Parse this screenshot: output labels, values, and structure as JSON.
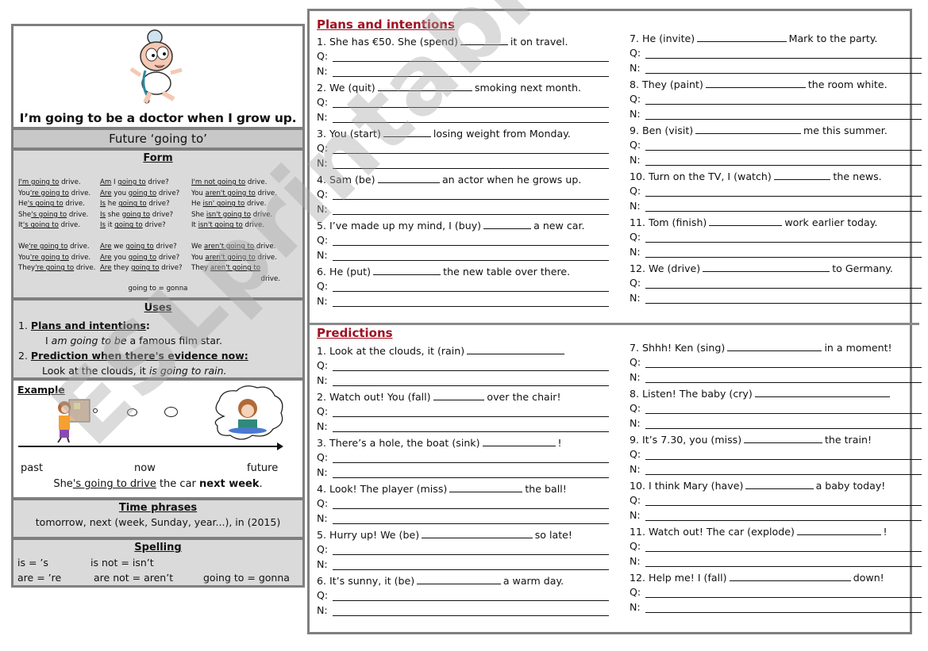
{
  "left": {
    "hero_caption": "I’m going to be a doctor when I grow up.",
    "hero_image": "baby-doctor-cartoon",
    "title": "Future ‘going to’",
    "form": {
      "heading": "Form",
      "rows": [
        {
          "aff_pre": "",
          "aff_u": "I'm going to",
          "aff_post": " drive.",
          "q_u1": "Am",
          "q_mid": " I ",
          "q_u2": "going to",
          "q_post": " drive?",
          "neg_pre": "",
          "neg_u": "I'm not going to",
          "neg_post": " drive."
        },
        {
          "aff_pre": "You",
          "aff_u": "'re going to",
          "aff_post": " drive.",
          "q_u1": "Are",
          "q_mid": " you ",
          "q_u2": "going to",
          "q_post": " drive?",
          "neg_pre": "You ",
          "neg_u": "aren't going to",
          "neg_post": " drive."
        },
        {
          "aff_pre": "He",
          "aff_u": "'s going to",
          "aff_post": " drive.",
          "q_u1": "Is",
          "q_mid": " he ",
          "q_u2": "going to",
          "q_post": " drive?",
          "neg_pre": "He ",
          "neg_u": "isn' going to",
          "neg_post": " drive."
        },
        {
          "aff_pre": "She",
          "aff_u": "'s going to",
          "aff_post": " drive.",
          "q_u1": "Is",
          "q_mid": " she ",
          "q_u2": "going to",
          "q_post": " drive?",
          "neg_pre": "She ",
          "neg_u": "isn't going to",
          "neg_post": " drive."
        },
        {
          "aff_pre": "It",
          "aff_u": "'s going to",
          "aff_post": " drive.",
          "q_u1": "Is",
          "q_mid": " it ",
          "q_u2": "going to",
          "q_post": " drive?",
          "neg_pre": "It ",
          "neg_u": "isn't going to",
          "neg_post": " drive."
        },
        {
          "aff_pre": "We",
          "aff_u": "'re going to",
          "aff_post": " drive.",
          "q_u1": "Are",
          "q_mid": " we ",
          "q_u2": "going to",
          "q_post": " drive?",
          "neg_pre": "We ",
          "neg_u": "aren't going to",
          "neg_post": " drive."
        },
        {
          "aff_pre": "You",
          "aff_u": "'re going to",
          "aff_post": " drive.",
          "q_u1": "Are",
          "q_mid": " you ",
          "q_u2": "going to",
          "q_post": " drive?",
          "neg_pre": "You ",
          "neg_u": "aren't going to",
          "neg_post": " drive."
        },
        {
          "aff_pre": "They",
          "aff_u": "'re going to",
          "aff_post": " drive.",
          "q_u1": "Are",
          "q_mid": " they ",
          "q_u2": "going to",
          "q_post": " drive?",
          "neg_pre": "They ",
          "neg_u": "aren't going to",
          "neg_post": ""
        }
      ],
      "wrap_word": "drive.",
      "note": "going to = gonna"
    },
    "uses": {
      "heading": "Uses",
      "item1_num": "1.",
      "item1_label": "Plans and intentions",
      "item1_colon": ":",
      "item1_ex_pre": "I ",
      "item1_ex_it": "am going to be",
      "item1_ex_post": " a famous film star.",
      "item2_num": "2.",
      "item2_label": "Prediction when there's evidence now:",
      "item2_ex_pre": "Look at the clouds, it ",
      "item2_ex_it": "is going to rain."
    },
    "example": {
      "heading": "Example",
      "image_left": "woman-at-noticeboard",
      "image_right": "woman-driving-thought-cloud",
      "past": "past",
      "now": "now",
      "future": "future",
      "sent_pre": "She",
      "sent_u": "'s going to drive",
      "sent_mid": " the car ",
      "sent_b": "next week",
      "sent_end": "."
    },
    "time_phrases": {
      "heading": "Time phrases",
      "text": "tomorrow, next (week, Sunday, year...), in (2015)"
    },
    "spelling": {
      "heading": "Spelling",
      "items": [
        "is = ’s",
        "is not = isn’t",
        "are = ’re",
        "are not = aren’t",
        "going to = gonna"
      ]
    }
  },
  "right": {
    "plans": {
      "title": "Plans and intentions",
      "items": [
        {
          "pre": "1. She has €50. She (spend)",
          "post": "it on travel."
        },
        {
          "pre": "2. We (quit)",
          "post": "smoking next month."
        },
        {
          "pre": "3. You (start)",
          "post": "losing weight from Monday."
        },
        {
          "pre": "4. Sam (be)",
          "post": "an actor when he grows up."
        },
        {
          "pre": "5. I’ve made up my mind, I (buy)",
          "post": "a new car."
        },
        {
          "pre": "6. He (put)",
          "post": "the new table over there."
        },
        {
          "pre": "7. He (invite)",
          "post": "Mark to the party."
        },
        {
          "pre": "8. They (paint)",
          "post": "the room white."
        },
        {
          "pre": "9. Ben (visit)",
          "post": "me this summer."
        },
        {
          "pre": "10. Turn on the TV, I (watch)",
          "post": "the news."
        },
        {
          "pre": "11. Tom (finish)",
          "post": "work earlier today."
        },
        {
          "pre": "12. We (drive)",
          "post": "to Germany."
        }
      ]
    },
    "predictions": {
      "title": "Predictions",
      "items": [
        {
          "pre": "1. Look at the clouds, it (rain)",
          "post": ""
        },
        {
          "pre": "2. Watch out! You (fall)",
          "post": "over the chair!"
        },
        {
          "pre": "3. There’s a hole, the boat (sink)",
          "post": "!"
        },
        {
          "pre": "4. Look! The player (miss)",
          "post": "the ball!"
        },
        {
          "pre": "5. Hurry up! We (be)",
          "post": "so late!"
        },
        {
          "pre": "6. It’s sunny, it (be)",
          "post": "a warm day."
        },
        {
          "pre": "7. Shhh! Ken (sing)",
          "post": "in a moment!"
        },
        {
          "pre": "8. Listen! The baby (cry)",
          "post": ""
        },
        {
          "pre": "9. It’s 7.30, you (miss)",
          "post": "the train!"
        },
        {
          "pre": "10. I think Mary (have)",
          "post": "a baby today!"
        },
        {
          "pre": "11. Watch out! The car (explode)",
          "post": "!"
        },
        {
          "pre": "12. Help me! I (fall)",
          "post": "down!"
        }
      ]
    },
    "q_label": "Q:",
    "n_label": "N:"
  },
  "watermark": "ESLprintables.com",
  "colors": {
    "section_title": "#a01020",
    "panel_gray": "#dadada",
    "title_gray": "#c8c8c8",
    "border": "#7f7f7f"
  }
}
